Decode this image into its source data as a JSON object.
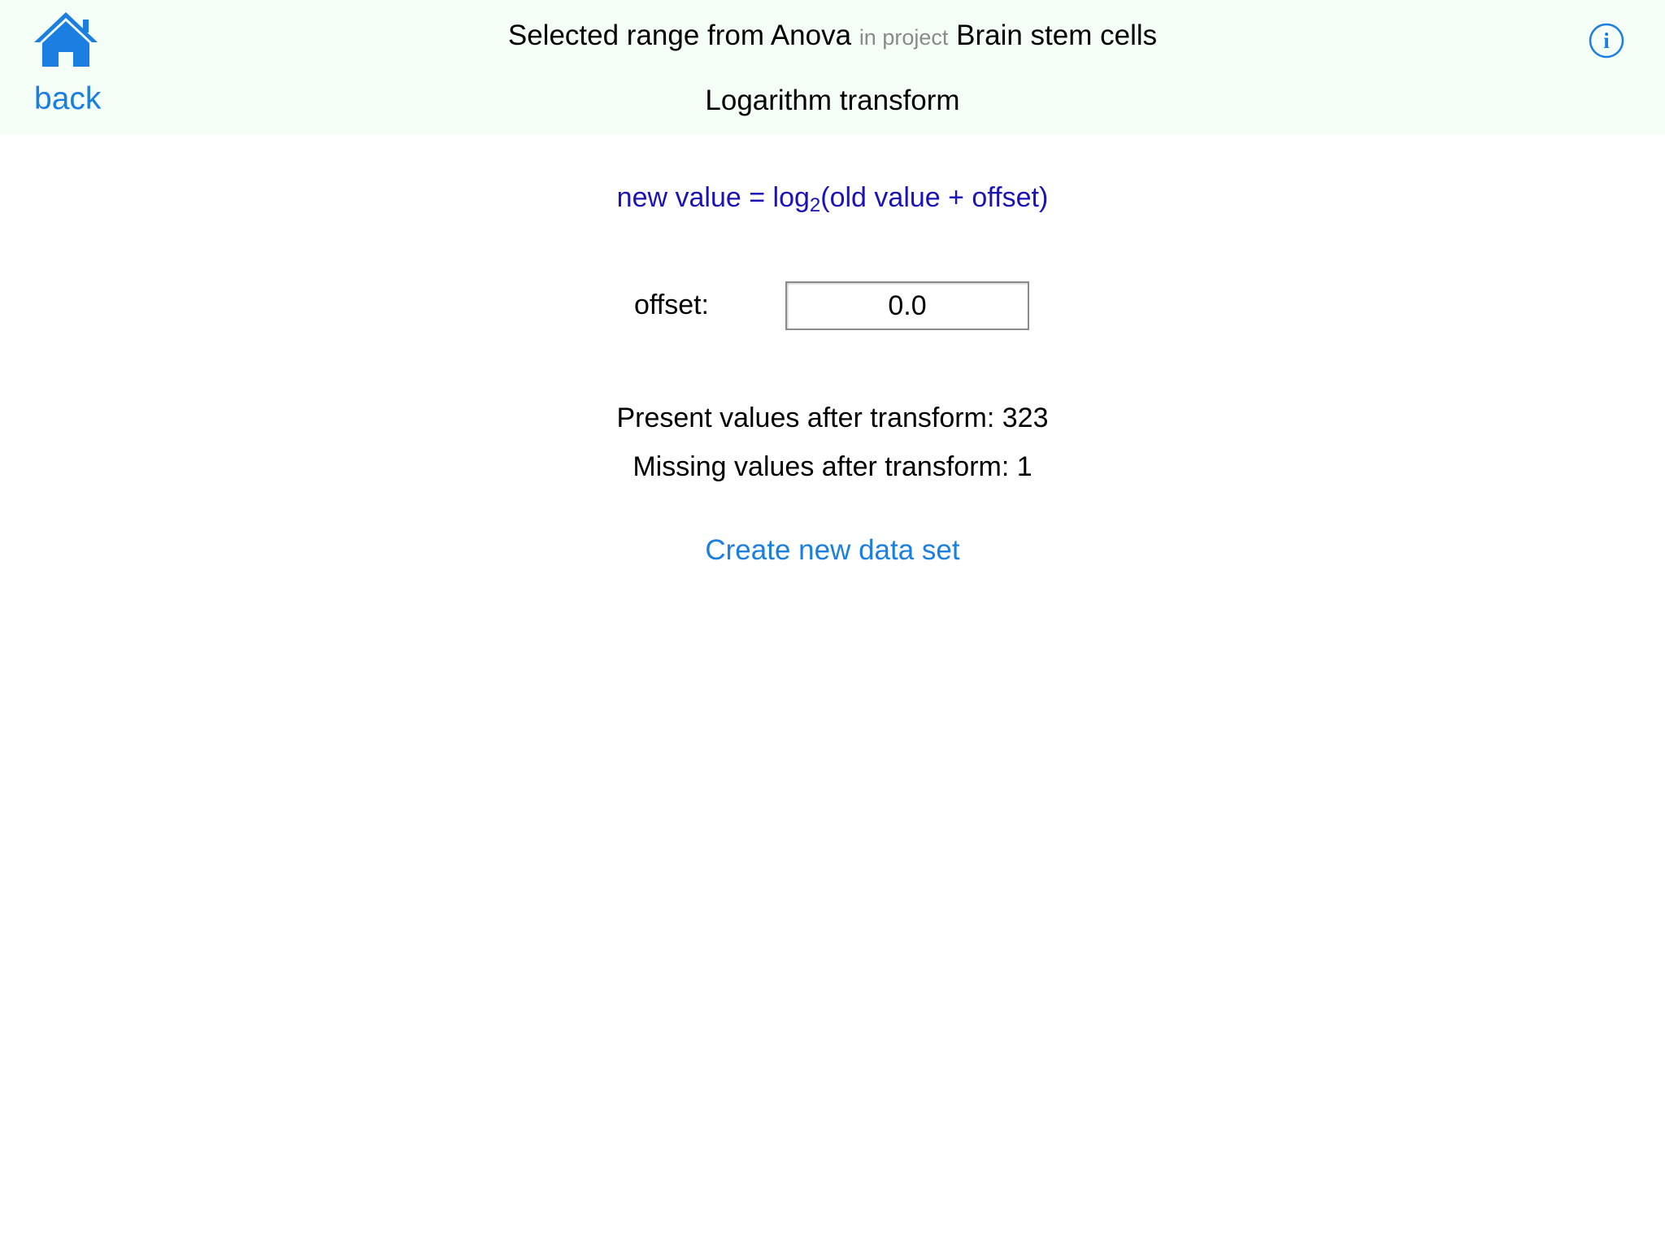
{
  "header": {
    "back_label": "back",
    "title": {
      "prefix": "Selected range from Anova",
      "connector": "in project",
      "project": "Brain stem cells"
    },
    "subtitle": "Logarithm transform",
    "home_icon": "home-icon",
    "info_icon": "info-icon",
    "info_glyph": "i"
  },
  "formula": {
    "lhs": "new value = log",
    "base": "2",
    "rhs": "(old value + offset)"
  },
  "offset": {
    "label": "offset:",
    "value": "0.0"
  },
  "stats": {
    "present": "Present values after transform: 323",
    "missing": "Missing values after transform: 1"
  },
  "action": {
    "create_label": "Create new data set"
  },
  "colors": {
    "header_bg": "#f4fdf6",
    "accent": "#1a7fe0",
    "formula": "#1b12b8",
    "muted": "#8a8a8a"
  }
}
